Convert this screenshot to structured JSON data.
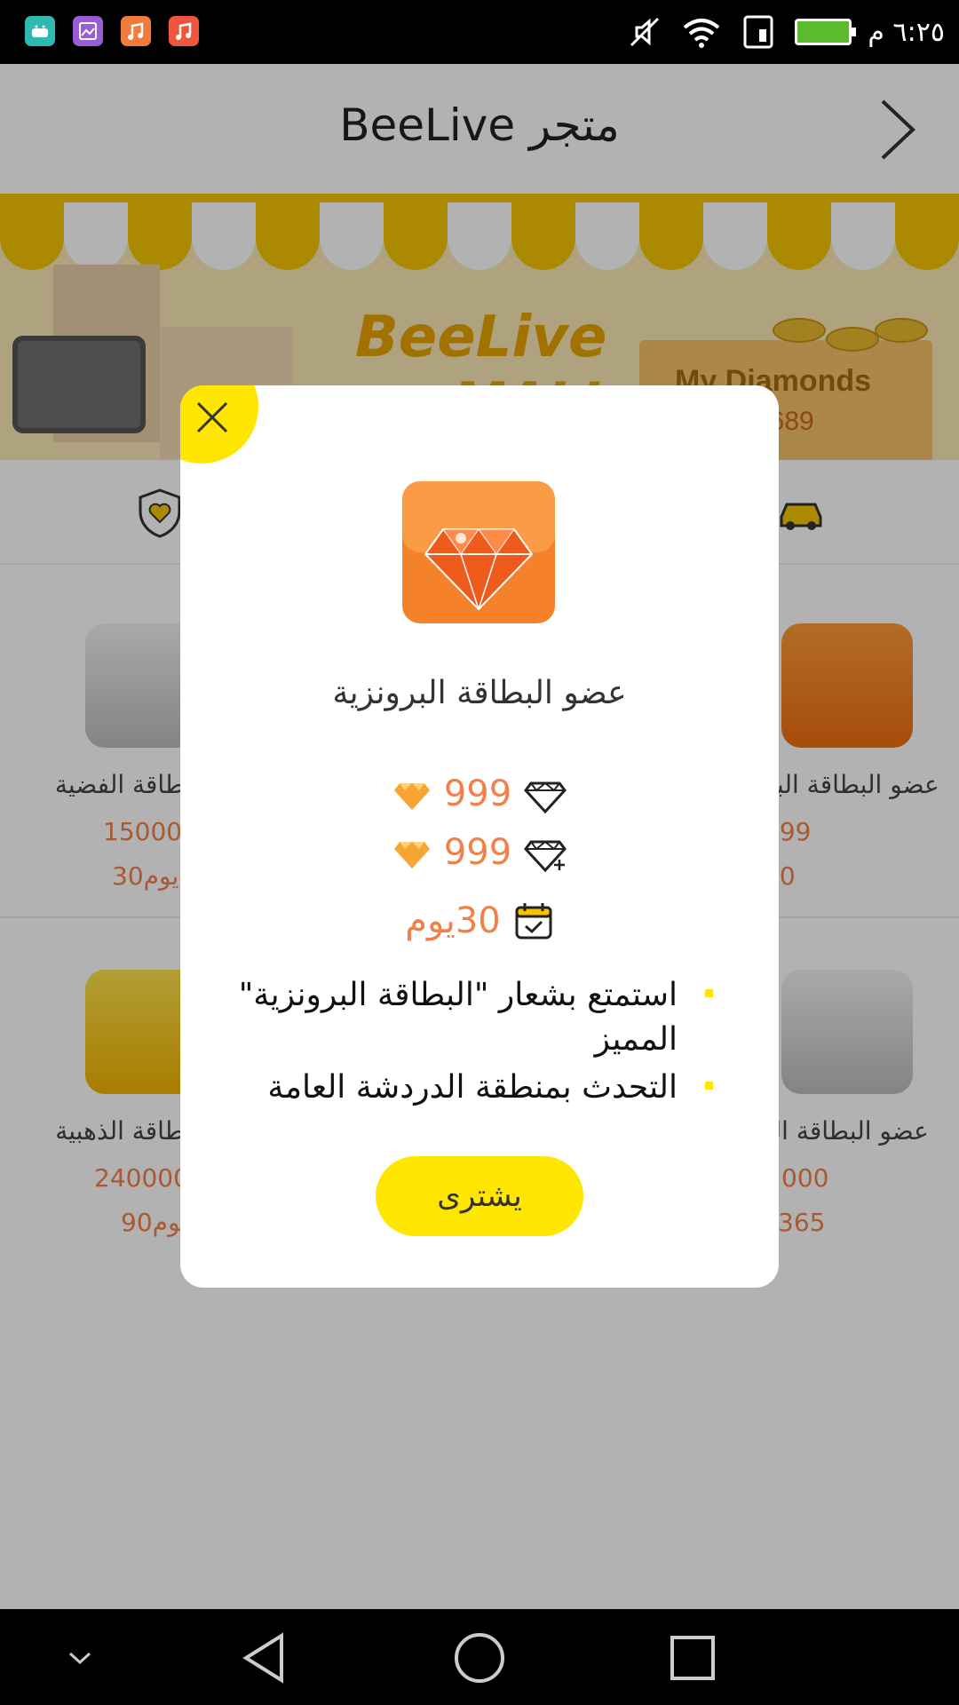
{
  "status_bar": {
    "time": "٦:٢٥ م",
    "apps": [
      "android-app-icon",
      "gallery-app-icon",
      "music-app-icon",
      "music-app-icon-2"
    ]
  },
  "header": {
    "title": "BeeLive متجر"
  },
  "banner": {
    "brand": "BeeLive",
    "mall": "MALL",
    "diamonds_label": "My Diamonds",
    "diamonds_count": "2689"
  },
  "cards": [
    {
      "name": "عضو البطاقة الفضية",
      "price": "15000",
      "days": "30يوم",
      "tile_color": "silver"
    },
    {
      "name": "عضو البطاقة البرونزية",
      "price": "999",
      "days": "30",
      "tile_color": "bronze"
    },
    {
      "name": "عضو البطاقة الذهبية",
      "price": "240000",
      "days": "90يوم",
      "tile_color": "gold"
    },
    {
      "name": "عضو البطاقة الماسية",
      "price": "000",
      "days": "365",
      "tile_color": "silver"
    }
  ],
  "modal": {
    "title": "عضو البطاقة البرونزية",
    "diamonds_value": "999",
    "bonus_value": "999",
    "days_value": "30يوم",
    "features": [
      "استمتع بشعار \"البطاقة البرونزية\" المميز",
      "التحدث بمنطقة الدردشة العامة"
    ],
    "buy_label": "يشترى"
  },
  "colors": {
    "accent_yellow": "#ffe600",
    "price_orange": "#f0814b",
    "overlay": "rgba(0,0,0,0.3)"
  }
}
